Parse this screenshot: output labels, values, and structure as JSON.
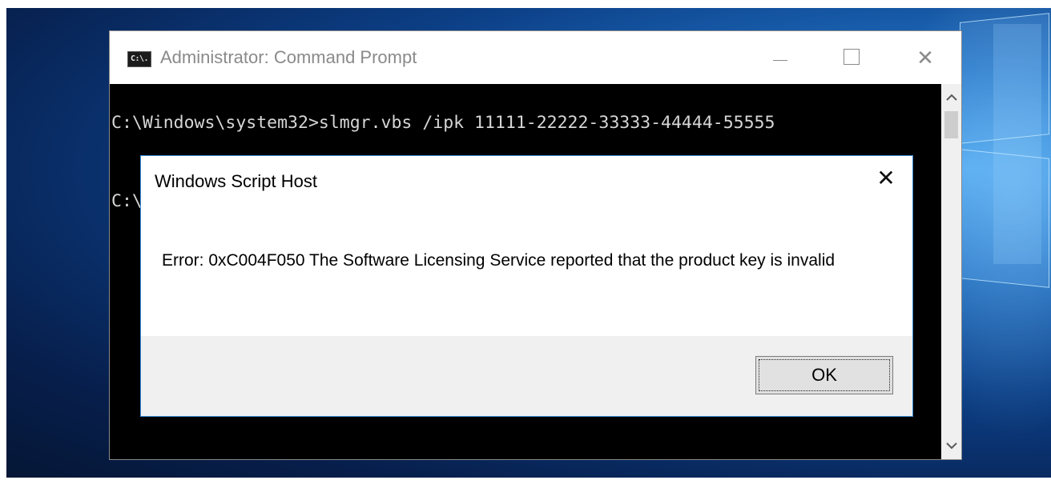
{
  "window": {
    "title": "Administrator: Command Prompt",
    "icon": "cmd-app-icon",
    "icon_text": "C:\\.",
    "minimize": "minimize-icon",
    "maximize": "maximize-icon",
    "close": "close-icon",
    "close_glyph": "✕"
  },
  "console": {
    "line1": "C:\\Windows\\system32>slmgr.vbs /ipk 11111-22222-33333-44444-55555",
    "line2": "C:\\"
  },
  "scrollbar": {
    "up": "▲",
    "down": "▼"
  },
  "dialog": {
    "title": "Windows Script Host",
    "close_glyph": "✕",
    "message": "Error: 0xC004F050 The Software Licensing Service reported that the product key is invalid",
    "ok_label": "OK"
  },
  "colors": {
    "dialog_border": "#3a8bd8",
    "console_bg": "#000000",
    "console_text": "#d6d6d6"
  }
}
